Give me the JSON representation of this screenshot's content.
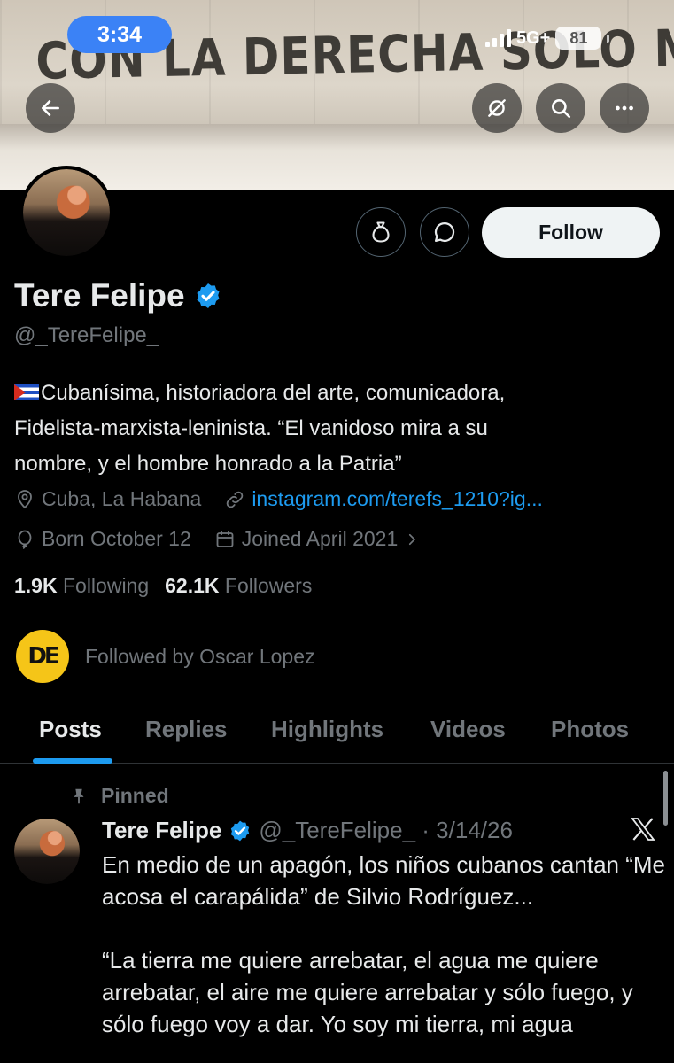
{
  "status_bar": {
    "time": "3:34",
    "network": "5G+",
    "battery": "81"
  },
  "banner": {
    "graffiti_text": "CON LA DERECHA SOLO ME MASTURBO"
  },
  "icons": {
    "back": "arrow-left-icon",
    "grok": "grok-icon",
    "search": "search-icon",
    "more": "more-horizontal-icon",
    "tip": "money-bag-icon",
    "message": "message-icon",
    "location": "location-pin-icon",
    "link": "link-icon",
    "birthday": "balloon-icon",
    "joined": "calendar-icon",
    "verified": "verified-badge-icon",
    "pin": "pin-icon",
    "x_logo": "x-logo-icon"
  },
  "colors": {
    "accent": "#1d9bf0",
    "verified": "#1d9bf0",
    "follow_bg": "#eff3f4",
    "time_pill": "#3b82f6"
  },
  "profile": {
    "name": "Tere Felipe",
    "handle": "@_TereFelipe_",
    "follow_label": "Follow",
    "bio_line1": "Cubanísima, historiadora del arte, comunicadora,",
    "bio_line2": "Fidelista-marxista-leninista. “El vanidoso mira a su",
    "bio_line3": "nombre, y el hombre honrado a la Patria”",
    "location": "Cuba, La Habana",
    "website": "instagram.com/terefs_1210?ig...",
    "born": "Born October 12",
    "joined": "Joined April 2021",
    "following_count": "1.9K",
    "following_label": "Following",
    "followers_count": "62.1K",
    "followers_label": "Followers",
    "followed_by_logo": "DE",
    "followed_by": "Followed by Oscar Lopez"
  },
  "tabs": [
    {
      "label": "Posts"
    },
    {
      "label": "Replies"
    },
    {
      "label": "Highlights"
    },
    {
      "label": "Videos"
    },
    {
      "label": "Photos"
    }
  ],
  "pinned_post": {
    "pinned_label": "Pinned",
    "author": "Tere Felipe",
    "handle_date": "@_TereFelipe_ · 3/14/26",
    "paragraph1": "En medio de un apagón, los niños cubanos cantan “Me acosa el carapálida” de Silvio Rodríguez...",
    "paragraph2": "“La tierra me quiere arrebatar, el agua me quiere arrebatar, el aire me quiere arrebatar y sólo fuego, y sólo fuego voy a dar. Yo soy mi tierra, mi agua"
  }
}
